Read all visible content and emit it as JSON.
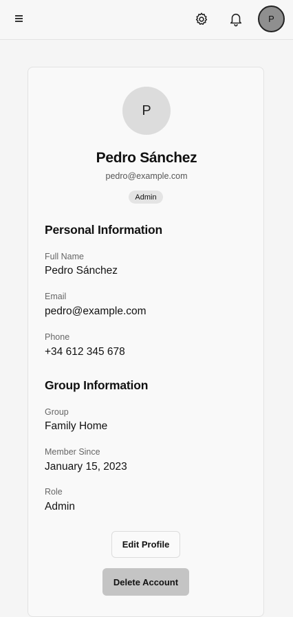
{
  "header": {
    "avatar_initial": "P"
  },
  "profile": {
    "avatar_initial": "P",
    "name": "Pedro Sánchez",
    "email": "pedro@example.com",
    "role_badge": "Admin"
  },
  "personal": {
    "title": "Personal Information",
    "fields": [
      {
        "label": "Full Name",
        "value": "Pedro Sánchez"
      },
      {
        "label": "Email",
        "value": "pedro@example.com"
      },
      {
        "label": "Phone",
        "value": "+34 612 345 678"
      }
    ]
  },
  "group": {
    "title": "Group Information",
    "fields": [
      {
        "label": "Group",
        "value": "Family Home"
      },
      {
        "label": "Member Since",
        "value": "January 15, 2023"
      },
      {
        "label": "Role",
        "value": "Admin"
      }
    ]
  },
  "actions": {
    "edit_label": "Edit Profile",
    "delete_label": "Delete Account"
  }
}
